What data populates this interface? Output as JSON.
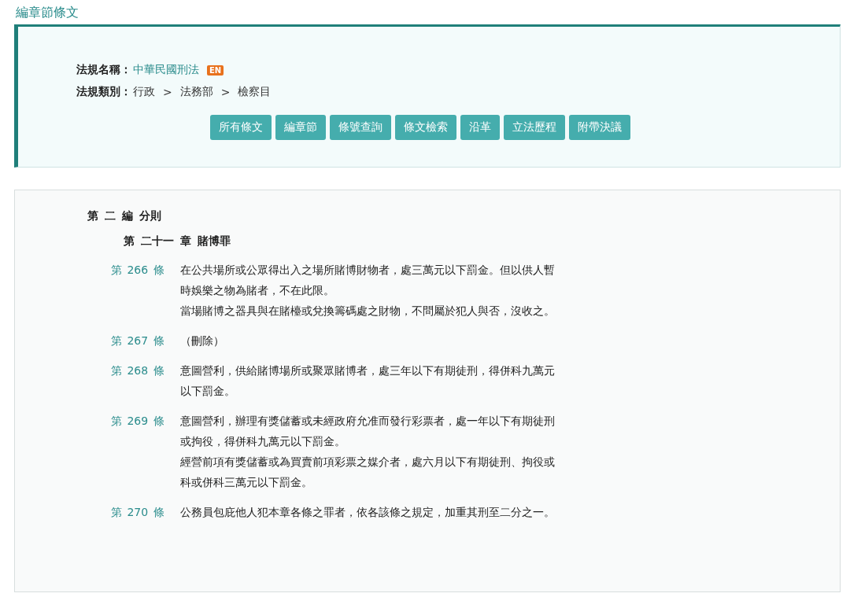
{
  "page_title": "編章節條文",
  "law": {
    "name_label": "法規名稱：",
    "name": "中華民國刑法",
    "en_badge": "EN",
    "category_label": "法規類別：",
    "category": [
      "行政",
      "法務部",
      "檢察目"
    ],
    "category_separator": ">"
  },
  "buttons": [
    {
      "label": "所有條文"
    },
    {
      "label": "編章節"
    },
    {
      "label": "條號查詢"
    },
    {
      "label": "條文檢索"
    },
    {
      "label": "沿革"
    },
    {
      "label": "立法歷程"
    },
    {
      "label": "附帶決議"
    }
  ],
  "part_heading": "第 二 編 分則",
  "chapter_heading": "第 二十一 章 賭博罪",
  "articles": [
    {
      "number": "第 266 條",
      "paragraphs": [
        "在公共場所或公眾得出入之場所賭博財物者，處三萬元以下罰金。但以供人暫時娛樂之物為賭者，不在此限。",
        "當場賭博之器具與在賭檯或兌換籌碼處之財物，不問屬於犯人與否，沒收之。"
      ]
    },
    {
      "number": "第 267 條",
      "paragraphs": [
        "（刪除）"
      ]
    },
    {
      "number": "第 268 條",
      "paragraphs": [
        "意圖營利，供給賭博場所或聚眾賭博者，處三年以下有期徒刑，得併科九萬元以下罰金。"
      ]
    },
    {
      "number": "第 269 條",
      "paragraphs": [
        "意圖營利，辦理有獎儲蓄或未經政府允准而發行彩票者，處一年以下有期徒刑或拘役，得併科九萬元以下罰金。",
        "經營前項有獎儲蓄或為買賣前項彩票之媒介者，處六月以下有期徒刑、拘役或科或併科三萬元以下罰金。"
      ]
    },
    {
      "number": "第 270 條",
      "paragraphs": [
        "公務員包庇他人犯本章各條之罪者，依各該條之規定，加重其刑至二分之一。"
      ]
    }
  ]
}
